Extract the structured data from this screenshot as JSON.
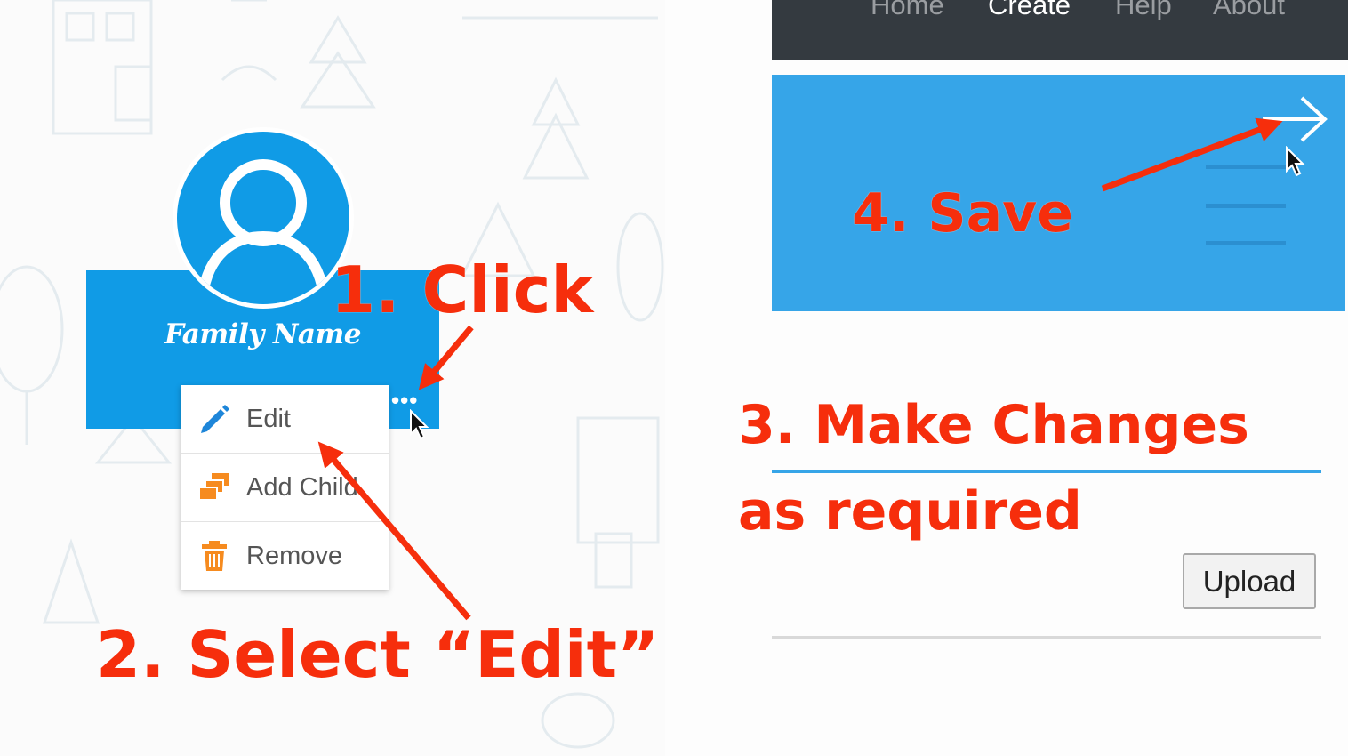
{
  "colors": {
    "accent_blue": "#109be6",
    "toolbar_blue": "#36a5e8",
    "navbar_dark": "#343a40",
    "annotation_red": "#f62e0c",
    "add_child_orange": "#f68b1f"
  },
  "navbar": {
    "links": [
      {
        "label": "Home",
        "active": false
      },
      {
        "label": "Create",
        "active": true
      },
      {
        "label": "Help",
        "active": false
      },
      {
        "label": "About",
        "active": false
      }
    ]
  },
  "tree_node": {
    "family_name": "Family Name",
    "more_icon": "ellipsis-horizontal-icon",
    "avatar_icon": "user-avatar-icon"
  },
  "context_menu": {
    "items": [
      {
        "label": "Edit",
        "icon": "pencil-icon"
      },
      {
        "label": "Add Child",
        "icon": "stacked-cards-icon"
      },
      {
        "label": "Remove",
        "icon": "trash-icon"
      }
    ]
  },
  "toolbar": {
    "save_icon": "arrow-right-icon",
    "menu_icon": "hamburger-icon"
  },
  "form": {
    "upload_label": "Upload"
  },
  "annotations": {
    "step1": "1. Click",
    "step2": "2. Select “Edit”",
    "step3_line1": "3. Make Changes",
    "step3_line2": "as required",
    "step4": "4. Save"
  }
}
